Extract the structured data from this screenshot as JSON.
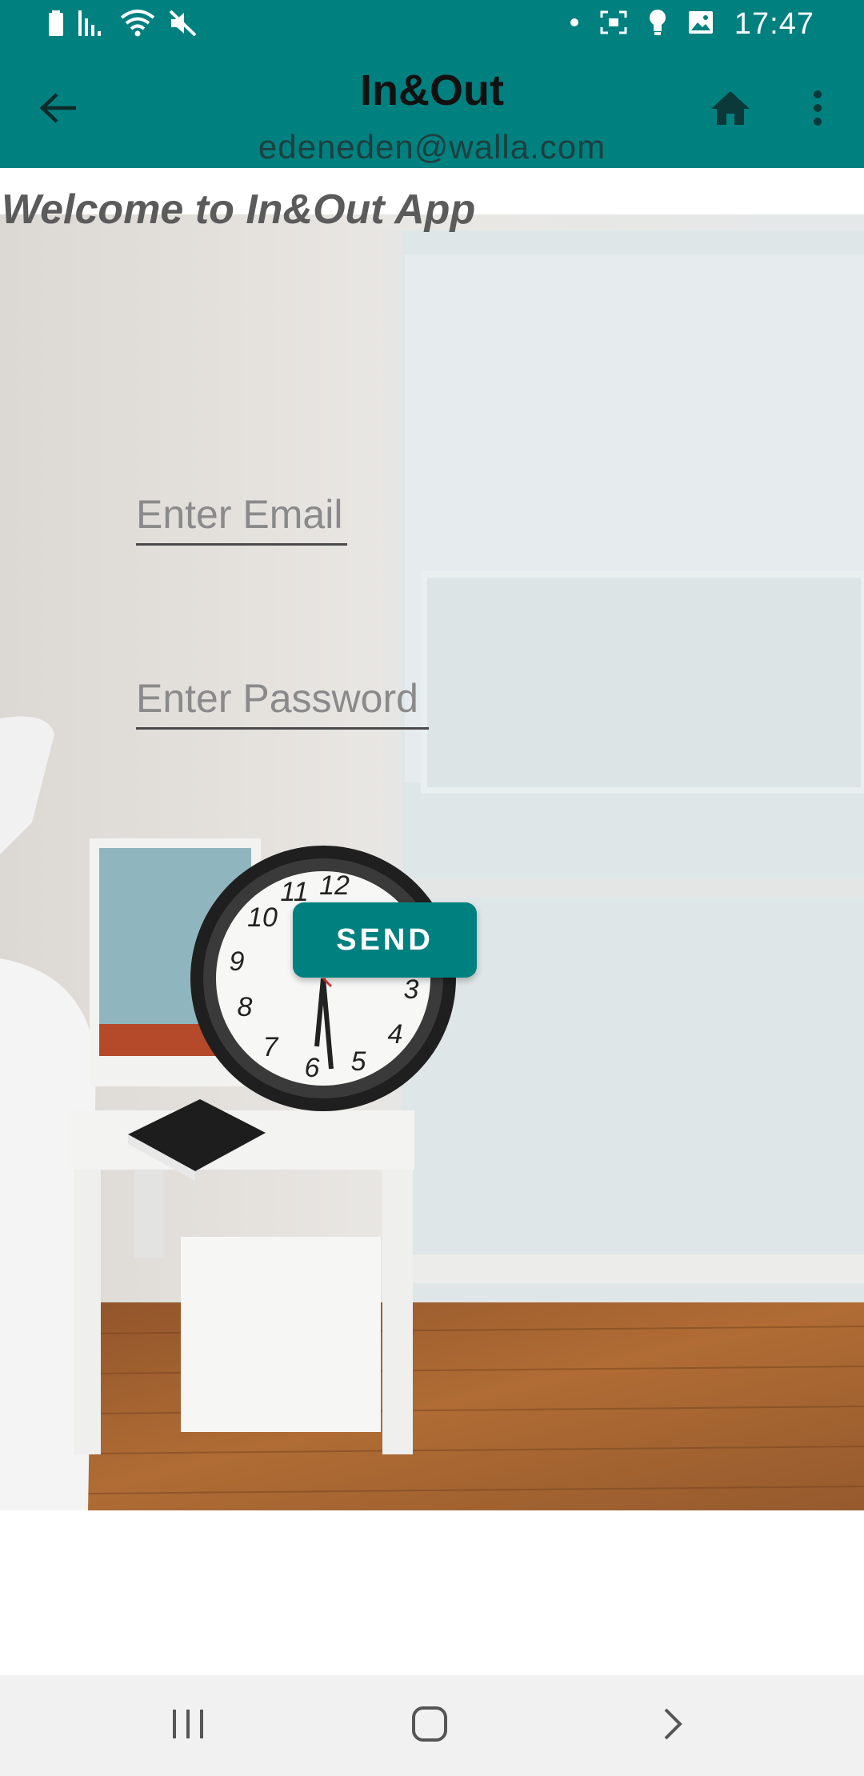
{
  "status_bar": {
    "time": "17:47",
    "left_icons": [
      "battery-icon",
      "signal-icon",
      "wifi-icon",
      "mute-icon"
    ],
    "right_icons": [
      "dot-icon",
      "screen-record-icon",
      "bulb-icon",
      "image-icon"
    ]
  },
  "app_bar": {
    "title": "In&Out",
    "subtitle": "edeneden@walla.com",
    "background": "#00807f"
  },
  "welcome": "Welcome to In&Out App",
  "form": {
    "email_placeholder": "Enter Email",
    "password_placeholder": "Enter Password",
    "send_label": "SEND"
  },
  "nav_bar": {
    "buttons": [
      "recents-icon",
      "home-circle-icon",
      "back-chevron-icon"
    ]
  }
}
